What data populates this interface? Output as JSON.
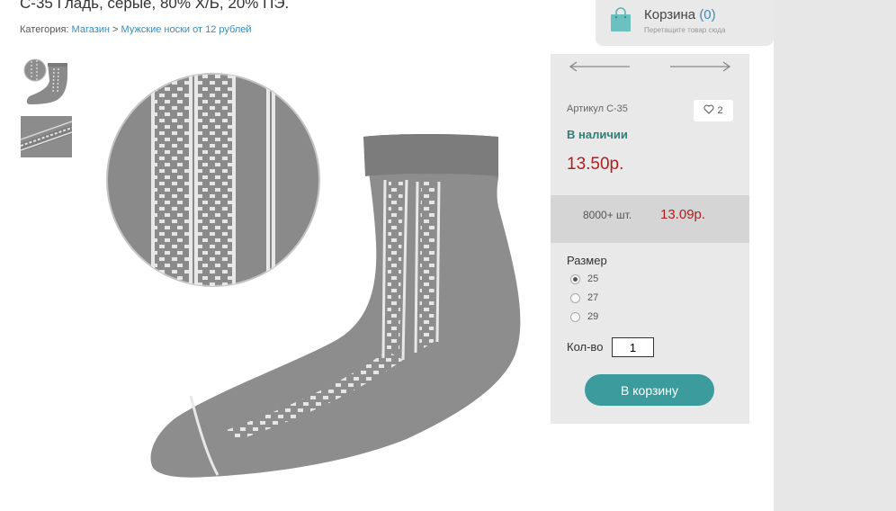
{
  "product": {
    "title": "С-35 Гладь, серые, 80% Х/Б, 20% ПЭ.",
    "category_label": "Категория:",
    "category_shop": "Магазин",
    "category_sep": " > ",
    "category_link": "Мужские носки от 12 рублей"
  },
  "cart": {
    "title": "Корзина",
    "count": "(0)",
    "hint": "Перетащите товар сюда"
  },
  "panel": {
    "sku": "Артикул С-35",
    "favorites": "2",
    "stock": "В наличии",
    "price": "13.50р.",
    "tier_qty": "8000+ шт.",
    "tier_price": "13.09р.",
    "size_label": "Размер",
    "sizes": [
      "25",
      "27",
      "29"
    ],
    "selected_size": "25",
    "qty_label": "Кол-во",
    "qty_value": "1",
    "buy_label": "В корзину"
  },
  "icons": {
    "cart": "shopping-bag-icon",
    "prev": "arrow-left-icon",
    "next": "arrow-right-icon",
    "favorite": "heart-icon"
  },
  "colors": {
    "accent": "#3c9b9d",
    "price": "#b01e1e",
    "stock": "#2f7f78",
    "link": "#3a8bbb"
  }
}
